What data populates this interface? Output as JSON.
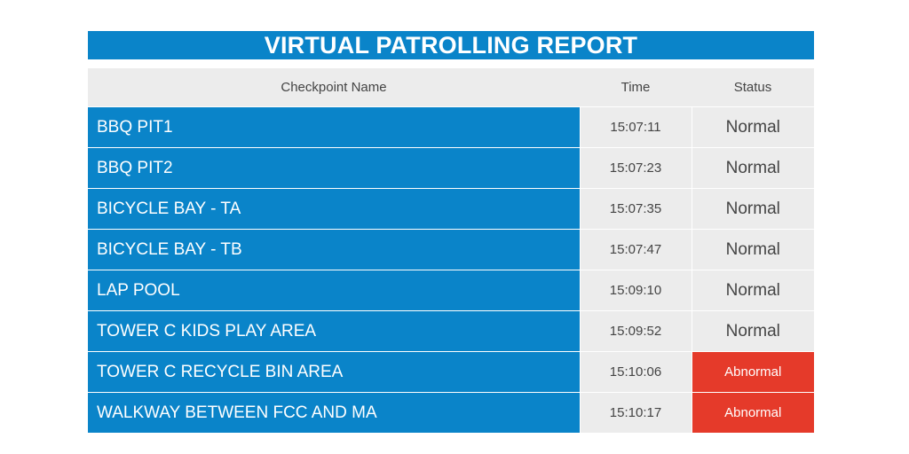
{
  "report": {
    "title": "VIRTUAL PATROLLING REPORT",
    "columns": {
      "checkpoint": "Checkpoint Name",
      "time": "Time",
      "status": "Status"
    },
    "rows": [
      {
        "name": "BBQ PIT1",
        "time": "15:07:11",
        "status": "Normal"
      },
      {
        "name": "BBQ PIT2",
        "time": "15:07:23",
        "status": "Normal"
      },
      {
        "name": "BICYCLE BAY - TA",
        "time": "15:07:35",
        "status": "Normal"
      },
      {
        "name": "BICYCLE BAY - TB",
        "time": "15:07:47",
        "status": "Normal"
      },
      {
        "name": "LAP POOL",
        "time": "15:09:10",
        "status": "Normal"
      },
      {
        "name": "TOWER C KIDS PLAY AREA",
        "time": "15:09:52",
        "status": "Normal"
      },
      {
        "name": "TOWER C RECYCLE BIN AREA",
        "time": "15:10:06",
        "status": "Abnormal"
      },
      {
        "name": "WALKWAY BETWEEN FCC AND MA",
        "time": "15:10:17",
        "status": "Abnormal"
      }
    ]
  },
  "colors": {
    "header_blue": "#0a84c9",
    "cell_grey": "#ececec",
    "abnormal_red": "#e53a2a"
  }
}
